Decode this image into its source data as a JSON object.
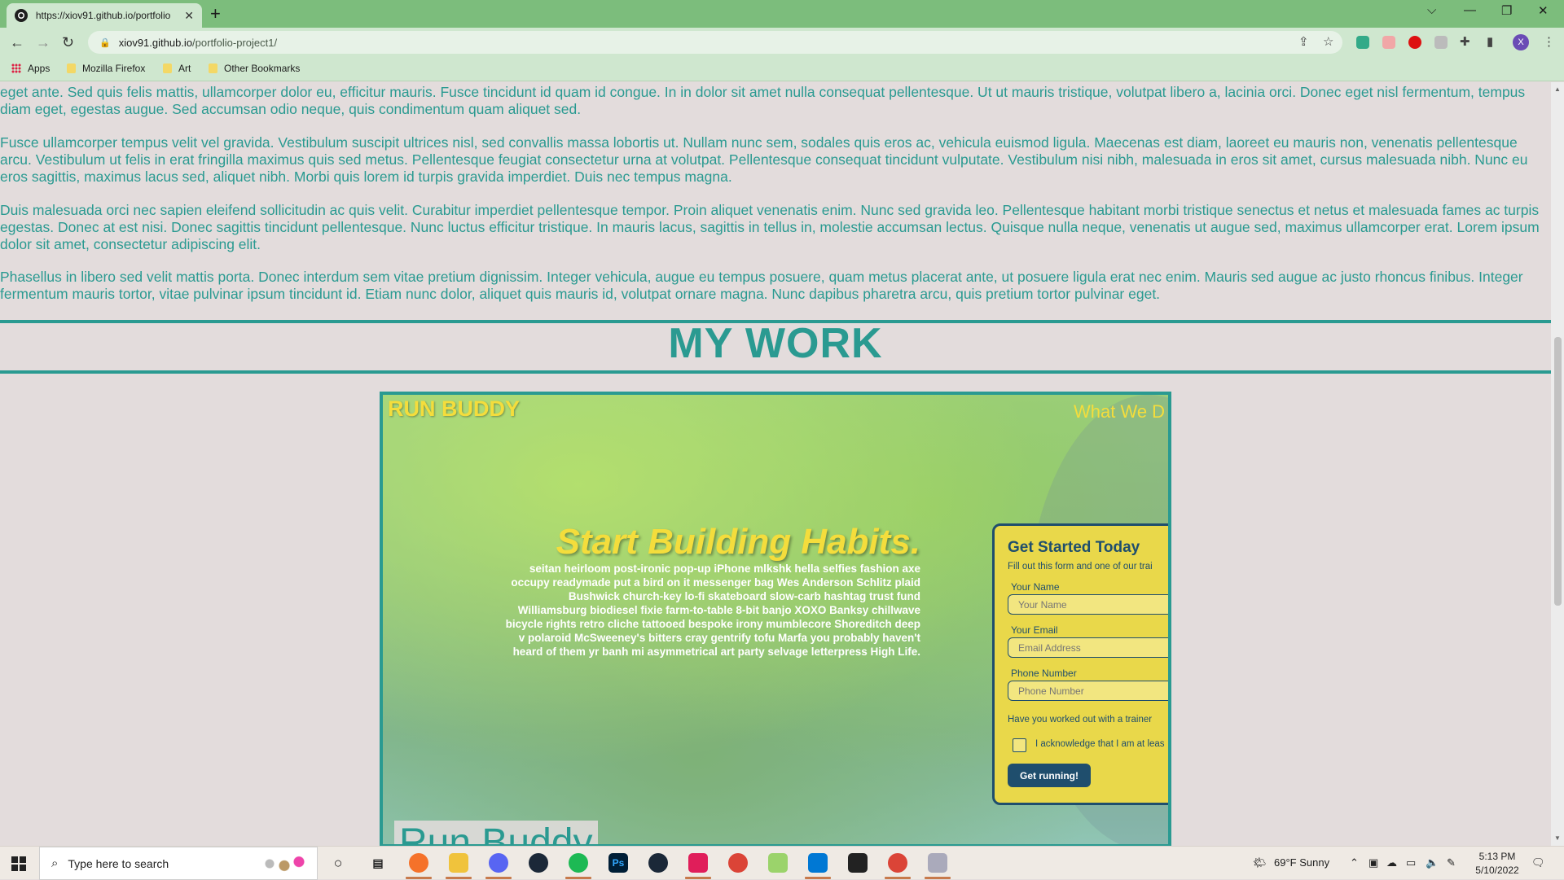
{
  "browser": {
    "tab_title": "https://xiov91.github.io/portfolio",
    "new_tab": "+",
    "url_host": "xiov91.github.io",
    "url_path": "/portfolio-project1/",
    "bookmarks": [
      "Apps",
      "Mozilla Firefox",
      "Art",
      "Other Bookmarks"
    ],
    "profile_initial": "X"
  },
  "page": {
    "paragraphs": [
      "eget ante. Sed quis felis mattis, ullamcorper dolor eu, efficitur mauris. Fusce tincidunt id quam id congue. In in dolor sit amet nulla consequat pellentesque. Ut ut mauris tristique, volutpat libero a, lacinia orci. Donec eget nisl fermentum, tempus diam eget, egestas augue. Sed accumsan odio neque, quis condimentum quam aliquet sed.",
      "Fusce ullamcorper tempus velit vel gravida. Vestibulum suscipit ultrices nisl, sed convallis massa lobortis ut. Nullam nunc sem, sodales quis eros ac, vehicula euismod ligula. Maecenas est diam, laoreet eu mauris non, venenatis pellentesque arcu. Vestibulum ut felis in erat fringilla maximus quis sed metus. Pellentesque feugiat consectetur urna at volutpat. Pellentesque consequat tincidunt vulputate. Vestibulum nisi nibh, malesuada in eros sit amet, cursus malesuada nibh. Nunc eu eros sagittis, maximus lacus sed, aliquet nibh. Morbi quis lorem id turpis gravida imperdiet. Duis nec tempus magna.",
      "Duis malesuada orci nec sapien eleifend sollicitudin ac quis velit. Curabitur imperdiet pellentesque tempor. Proin aliquet venenatis enim. Nunc sed gravida leo. Pellentesque habitant morbi tristique senectus et netus et malesuada fames ac turpis egestas. Donec at est nisi. Donec sagittis tincidunt pellentesque. Nunc luctus efficitur tristique. In mauris lacus, sagittis in tellus in, molestie accumsan lectus. Quisque nulla neque, venenatis ut augue sed, maximus ullamcorper erat. Lorem ipsum dolor sit amet, consectetur adipiscing elit.",
      "Phasellus in libero sed velit mattis porta. Donec interdum sem vitae pretium dignissim. Integer vehicula, augue eu tempus posuere, quam metus placerat ante, ut posuere ligula erat nec enim. Mauris sed augue ac justo rhoncus finibus. Integer fermentum mauris tortor, vitae pulvinar ipsum tincidunt id. Etiam nunc dolor, aliquet quis mauris id, volutpat ornare magna. Nunc dapibus pharetra arcu, quis pretium tortor pulvinar eget."
    ],
    "section_title": "MY WORK",
    "project": {
      "logo": "RUN BUDDY",
      "nav_text": "What We D",
      "hero_title": "Start Building Habits.",
      "hero_body": "seitan heirloom post-ironic pop-up iPhone mlkshk hella selfies fashion axe occupy readymade put a bird on it messenger bag Wes Anderson Schlitz plaid Bushwick church-key lo-fi skateboard slow-carb hashtag trust fund Williamsburg biodiesel fixie farm-to-table 8-bit banjo XOXO Banksy chillwave bicycle rights retro cliche tattooed bespoke irony mumblecore Shoreditch deep v polaroid McSweeney's bitters cray gentrify tofu Marfa you probably haven't heard of them yr banh mi asymmetrical art party selvage letterpress High Life.",
      "form": {
        "title": "Get Started Today",
        "subtitle": "Fill out this form and one of our trai",
        "name_label": "Your Name",
        "name_placeholder": "Your Name",
        "email_label": "Your Email",
        "email_placeholder": "Email Address",
        "phone_label": "Phone Number",
        "phone_placeholder": "Phone Number",
        "trainer_question": "Have you worked out with a trainer",
        "acknowledge": "I acknowledge that I am at leas",
        "submit": "Get running!"
      },
      "caption": "Run Buddy"
    }
  },
  "taskbar": {
    "search_placeholder": "Type here to search",
    "weather": "69°F  Sunny",
    "time": "5:13 PM",
    "date": "5/10/2022"
  },
  "colors": {
    "accent": "#2a9a91",
    "chrome": "#7cbd7c",
    "run_buddy_yellow": "#f4dd3c",
    "run_buddy_navy": "#1f4e6d"
  }
}
